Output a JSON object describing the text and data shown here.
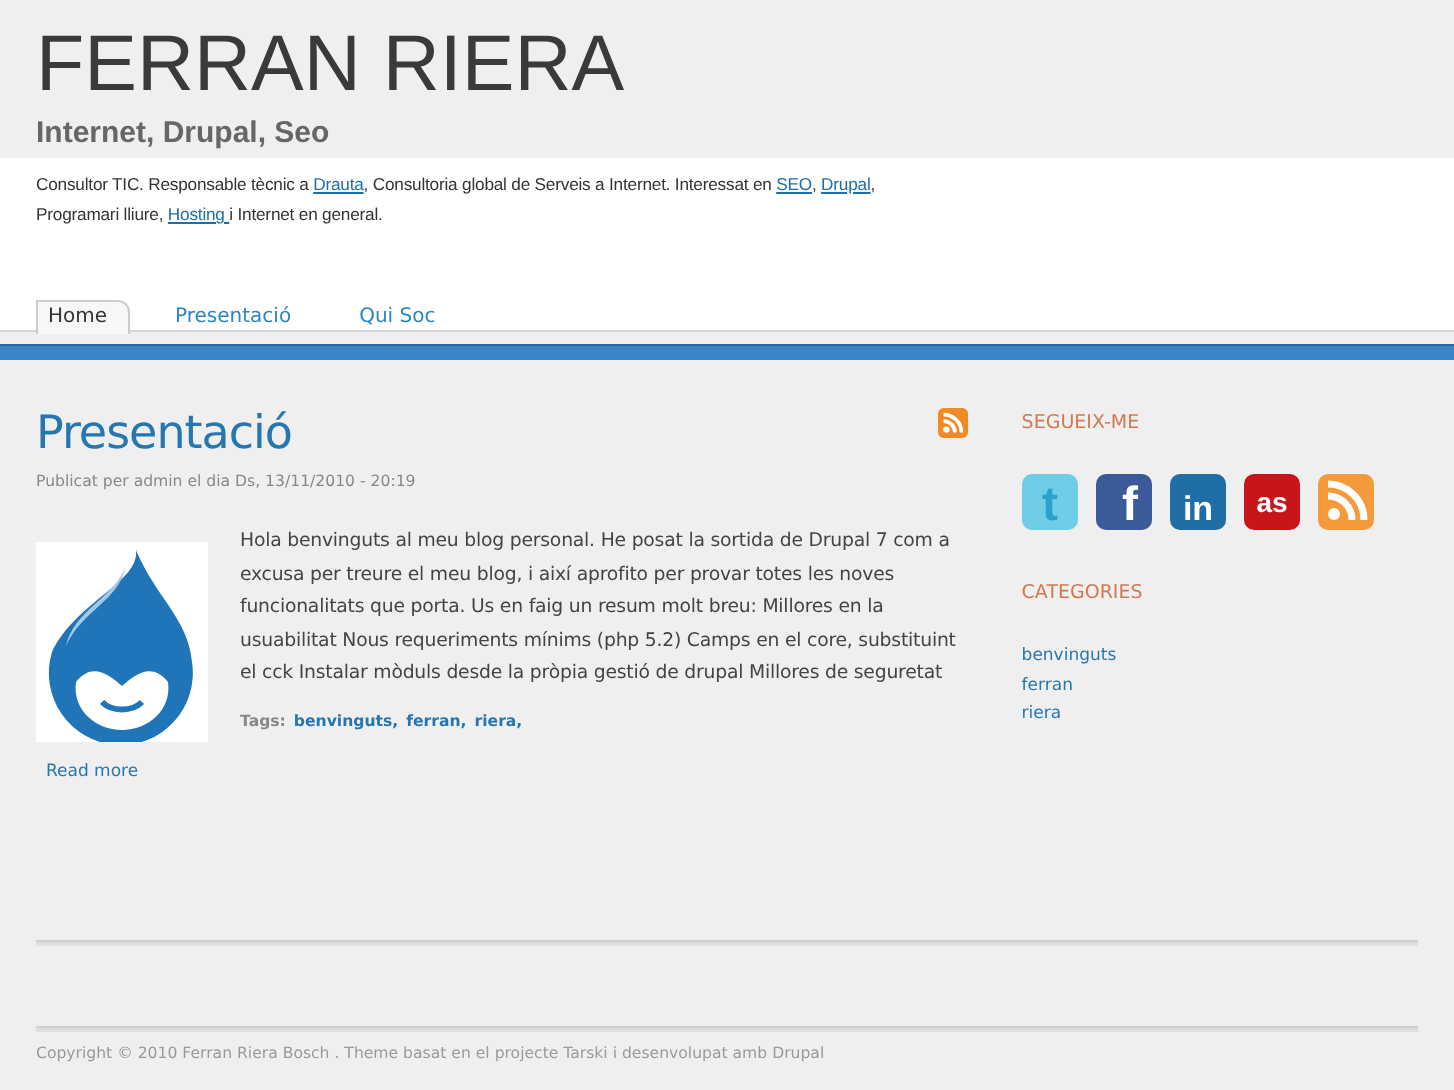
{
  "site": {
    "title": "FERRAN RIERA",
    "slogan": "Internet, Drupal, Seo",
    "description": [
      {
        "text": "Consultor TIC. Responsable tècnic a ",
        "link": false
      },
      {
        "text": "Drauta",
        "link": true
      },
      {
        "text": ", Consultoria global de Serveis a Internet. Interessat en ",
        "link": false
      },
      {
        "text": "SEO",
        "link": true
      },
      {
        "text": ", ",
        "link": false
      },
      {
        "text": "Drupal",
        "link": true
      },
      {
        "text": ", Programari lliure, ",
        "link": false
      },
      {
        "text": "Hosting ",
        "link": true
      },
      {
        "text": " i Internet en general.",
        "link": false
      }
    ]
  },
  "tabs": [
    {
      "label": "Home",
      "selected": true
    },
    {
      "label": "Presentació",
      "selected": false
    },
    {
      "label": "Qui Soc",
      "selected": false
    }
  ],
  "post": {
    "title": "Presentació",
    "meta": "Publicat per admin el dia Ds, 13/11/2010 - 20:19",
    "body": "Hola benvinguts al meu blog personal. He posat la sortida de Drupal 7 com a excusa per treure el meu blog, i així aprofito per provar totes les noves funcionalitats que porta. Us en faig un resum molt breu: Millores en la usuabilitat Nous requeriments mínims (php 5.2) Camps en el core, substituint el cck Instalar mòduls desde la pròpia gestió de drupal Millores de seguretat",
    "tags_label": "Tags:",
    "tags": [
      "benvinguts,",
      "ferran,",
      "riera,"
    ],
    "read_more": "Read more"
  },
  "sidebar": {
    "follow_title": "SEGUEIX-ME",
    "social": [
      {
        "kind": "twitter",
        "glyph": "t"
      },
      {
        "kind": "facebook",
        "glyph": "f"
      },
      {
        "kind": "linkedin",
        "glyph": "in"
      },
      {
        "kind": "lastfm",
        "glyph": "as"
      },
      {
        "kind": "rss"
      }
    ],
    "categories_title": "CATEGORIES",
    "categories": [
      "benvinguts",
      "ferran",
      "riera"
    ]
  },
  "footer": "Copyright © 2010 Ferran Riera Bosch . Theme basat en el projecte Tarski i desenvolupat amb Drupal"
}
